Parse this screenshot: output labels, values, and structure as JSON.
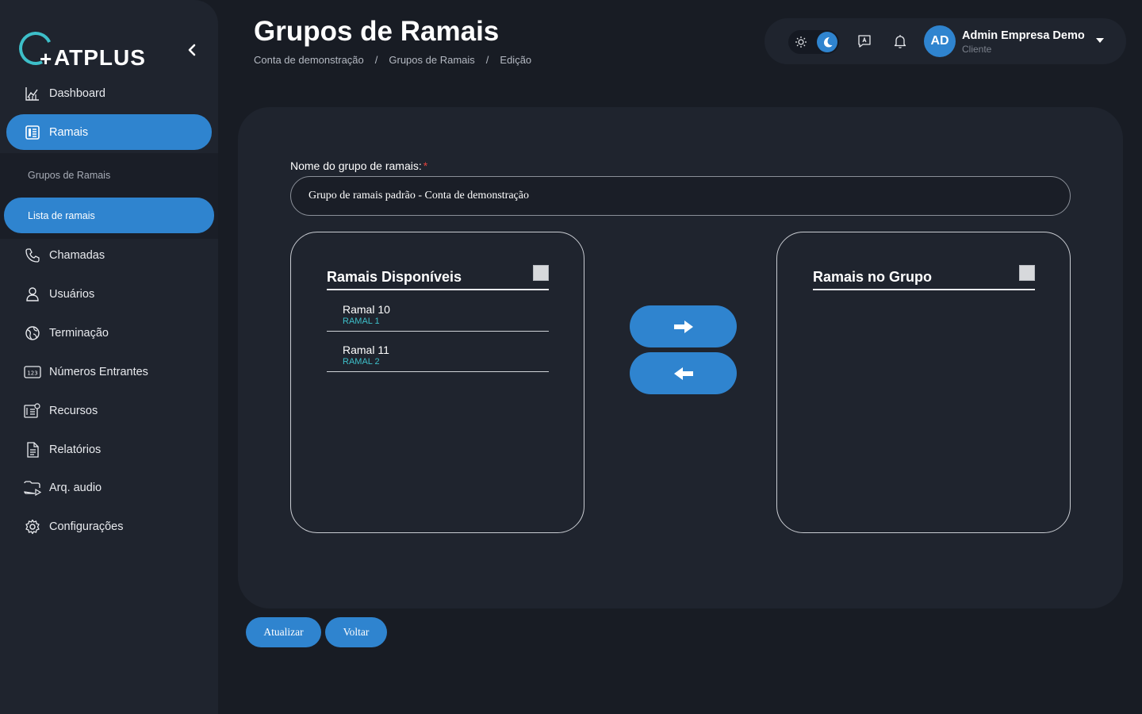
{
  "brand": {
    "name": "ATPLUS"
  },
  "colors": {
    "accent": "#2f84cf",
    "teal": "#3dbfc9",
    "background": "#181c24",
    "panel": "#1f242e",
    "required": "#e0423c"
  },
  "sidebar": {
    "items": [
      {
        "label": "Dashboard",
        "icon": "chart-icon"
      },
      {
        "label": "Ramais",
        "icon": "phonebook-icon",
        "active": true
      },
      {
        "label": "Chamadas",
        "icon": "phone-icon"
      },
      {
        "label": "Usuários",
        "icon": "user-icon"
      },
      {
        "label": "Terminação",
        "icon": "globe-icon"
      },
      {
        "label": "Números Entrantes",
        "icon": "numbers-icon"
      },
      {
        "label": "Recursos",
        "icon": "resources-icon"
      },
      {
        "label": "Relatórios",
        "icon": "document-icon"
      },
      {
        "label": "Arq. audio",
        "icon": "audio-folder-icon"
      },
      {
        "label": "Configurações",
        "icon": "gear-icon"
      }
    ],
    "submenu": [
      {
        "label": "Grupos de Ramais"
      },
      {
        "label": "Lista de ramais",
        "active": true
      }
    ]
  },
  "header": {
    "title": "Grupos de Ramais",
    "breadcrumb": [
      "Conta de demonstração",
      "Grupos de Ramais",
      "Edição"
    ],
    "separator": "/"
  },
  "user": {
    "initials": "AD",
    "name": "Admin Empresa Demo",
    "role": "Cliente"
  },
  "form": {
    "name_label": "Nome do grupo de ramais:",
    "required_mark": "*",
    "name_value": "Grupo de ramais padrão - Conta de demonstração"
  },
  "available": {
    "title": "Ramais Disponíveis",
    "items": [
      {
        "name": "Ramal 10",
        "sub": "RAMAL 1"
      },
      {
        "name": "Ramal 11",
        "sub": "RAMAL 2"
      }
    ]
  },
  "in_group": {
    "title": "Ramais no Grupo",
    "items": []
  },
  "actions": {
    "update": "Atualizar",
    "back": "Voltar"
  }
}
